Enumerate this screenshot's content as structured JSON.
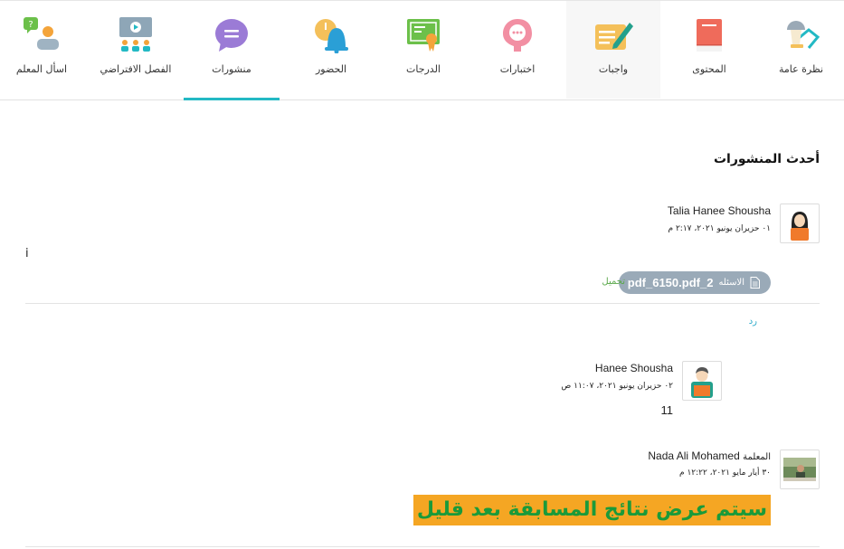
{
  "nav": {
    "tabs": [
      {
        "label": "نظرة عامة",
        "icon": "overview-icon"
      },
      {
        "label": "المحتوى",
        "icon": "book-icon"
      },
      {
        "label": "واجبات",
        "icon": "assignment-icon"
      },
      {
        "label": "اختبارات",
        "icon": "quiz-icon"
      },
      {
        "label": "الدرجات",
        "icon": "certificate-icon"
      },
      {
        "label": "الحضور",
        "icon": "bell-clock-icon"
      },
      {
        "label": "منشورات",
        "icon": "chat-bubble-icon"
      },
      {
        "label": "الفصل الافتراضي",
        "icon": "virtual-class-icon"
      },
      {
        "label": "اسأل المعلم",
        "icon": "ask-teacher-icon"
      }
    ],
    "active_tab": "منشورات"
  },
  "colors": {
    "accent": "#23b9c4",
    "attachment_bg": "#9aaab8",
    "banner_bg": "#f5a623",
    "banner_text": "#1a9a3a"
  },
  "section_title": "أحدث المنشورات",
  "posts": [
    {
      "author": "Talia Hanee Shousha",
      "date": "٠١ حزيران يونيو ٢٠٢١، ٢:١٧ م",
      "body": "i",
      "attachment": {
        "name": "pdf_6150.pdf_2",
        "prefix": "الاسئله",
        "download_label": "تحميل"
      },
      "reply_label": "رد",
      "replies": [
        {
          "author": "Hanee Shousha",
          "date": "٠٢ حزيران يونيو ٢٠٢١، ١١:٠٧ ص",
          "body": "11"
        }
      ]
    },
    {
      "role": "المعلمة",
      "author": "Nada Ali Mohamed",
      "date": "٣٠ أيار مايو ٢٠٢١، ١٢:٢٢ م",
      "body": "سيتم عرض نتائج المسابقة بعد قليل"
    }
  ]
}
